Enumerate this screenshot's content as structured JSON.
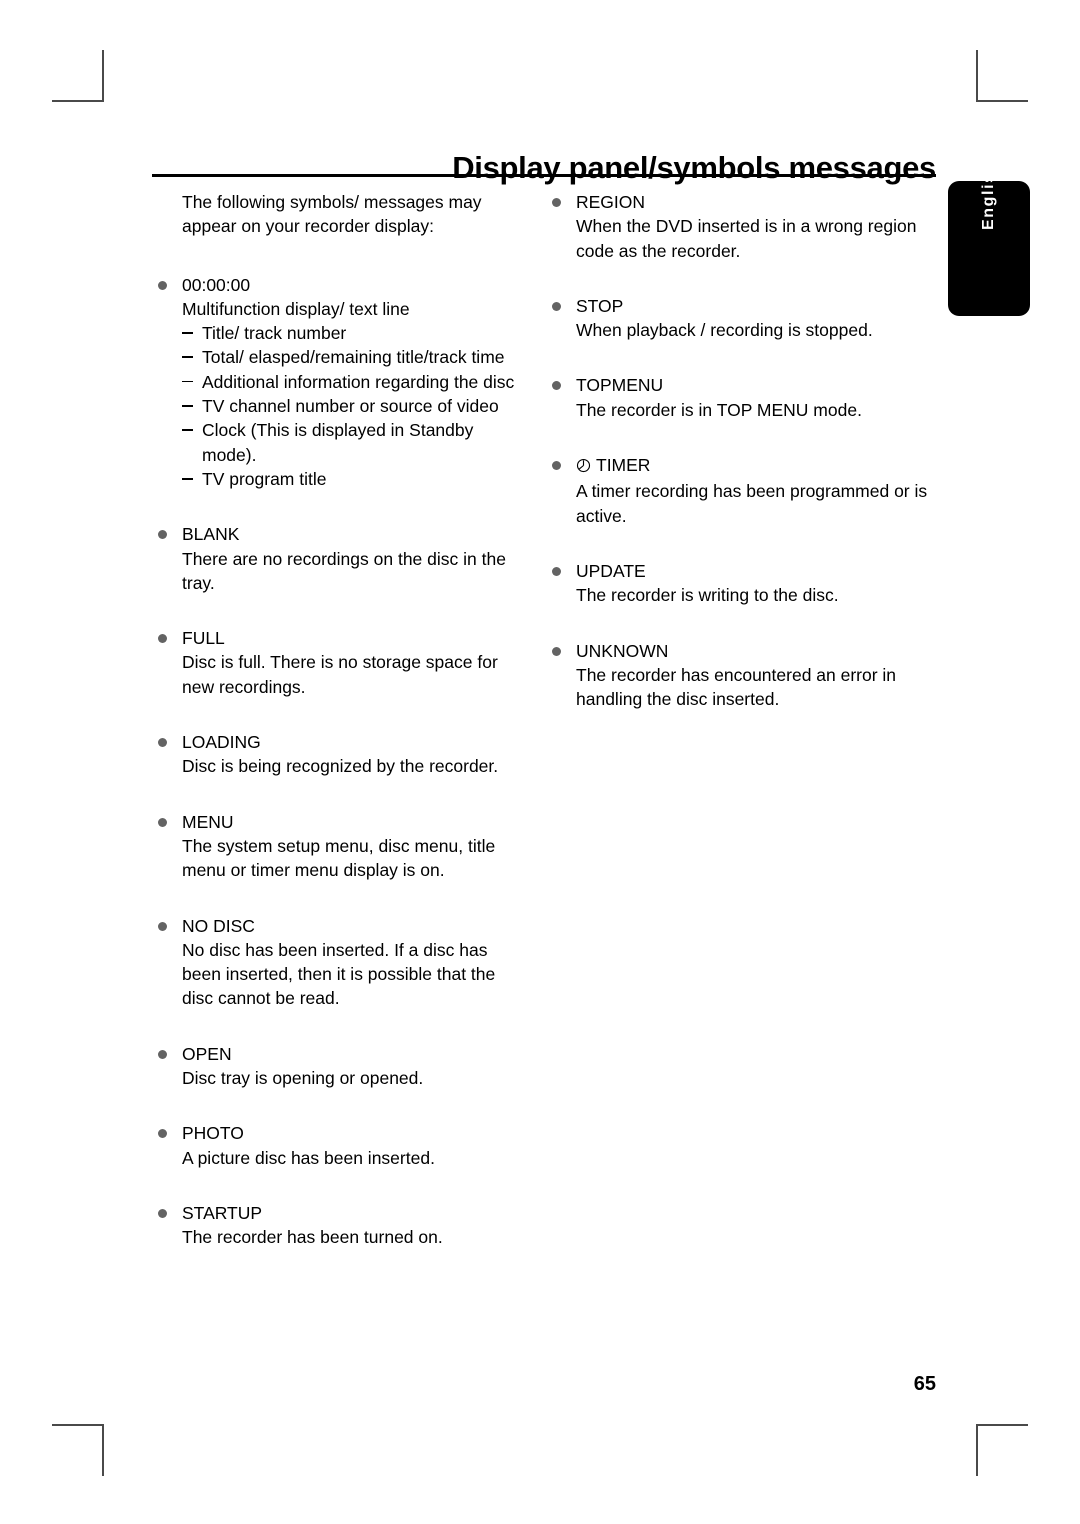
{
  "header": {
    "title": "Display panel/symbols messages"
  },
  "side_tab": {
    "language": "English"
  },
  "left_column": {
    "intro": "The following symbols/ messages may appear on your recorder display:",
    "entries": [
      {
        "term": "00:00:00",
        "desc": "Multifunction display/ text line",
        "sublist": [
          "Title/ track number",
          "Total/ elasped/remaining title/track time",
          "Additional information regarding the disc",
          "TV channel number or source of video",
          "Clock (This is displayed in Standby mode).",
          "TV program title"
        ]
      },
      {
        "term": "BLANK",
        "desc": "There are no recordings on the disc in the tray."
      },
      {
        "term": "FULL",
        "desc": "Disc is full. There is no storage space for new recordings."
      },
      {
        "term": "LOADING",
        "desc": "Disc is being recognized by the recorder."
      },
      {
        "term": "MENU",
        "desc": "The system setup menu, disc menu, title menu or timer menu display is on."
      },
      {
        "term": "NO DISC",
        "desc": "No disc has been inserted. If a disc has been inserted, then it is possible that the disc cannot be read."
      },
      {
        "term": "OPEN",
        "desc": "Disc tray is opening or opened."
      },
      {
        "term": "PHOTO",
        "desc": "A picture disc has been inserted."
      },
      {
        "term": "STARTUP",
        "desc": "The recorder has been turned on."
      }
    ]
  },
  "right_column": {
    "entries": [
      {
        "term": "REGION",
        "desc": "When the DVD inserted is in a wrong region code as the recorder."
      },
      {
        "term": "STOP",
        "desc": "When playback / recording is stopped."
      },
      {
        "term": "TOPMENU",
        "desc": "The recorder is in TOP MENU mode."
      },
      {
        "term": "TIMER",
        "icon": "clock-icon",
        "desc": "A timer recording has been programmed or is active."
      },
      {
        "term": "UPDATE",
        "desc": "The recorder is writing to the disc."
      },
      {
        "term": "UNKNOWN",
        "desc": "The recorder has encountered an error in handling the disc inserted."
      }
    ]
  },
  "footer": {
    "page_number": "65"
  },
  "colors": {
    "bullet": "#636363",
    "rule": "#000000",
    "tab_background": "#000000",
    "tab_text": "#ffffff",
    "crop_mark": "#4a4a4a"
  }
}
